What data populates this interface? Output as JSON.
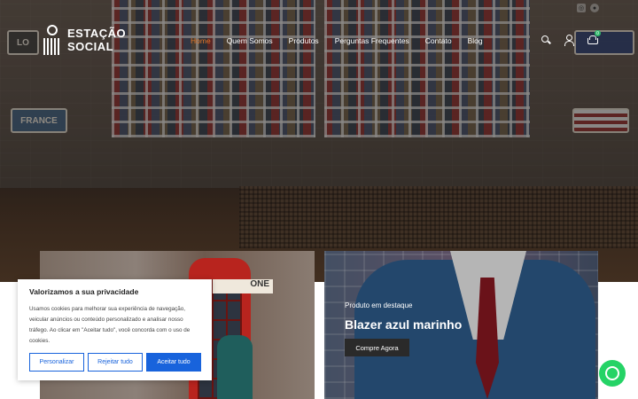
{
  "logo": {
    "line1": "ESTAÇÃO",
    "line2": "SOCIAL"
  },
  "nav": [
    {
      "label": "Home",
      "active": true
    },
    {
      "label": "Quem Somos"
    },
    {
      "label": "Produtos"
    },
    {
      "label": "Perguntas Frequentes"
    },
    {
      "label": "Contato"
    },
    {
      "label": "Blog"
    }
  ],
  "social_icons": [
    "instagram-icon",
    "facebook-icon"
  ],
  "header_icons": [
    "search-icon",
    "user-icon",
    "cart-icon"
  ],
  "cart": {
    "count": "0"
  },
  "hero_signs": {
    "love": "LO",
    "france": "FRANCE"
  },
  "card_left": {
    "sign": "ONE"
  },
  "featured": {
    "label": "Produto em destaque",
    "title": "Blazer azul marinho",
    "button": "Compre Agora"
  },
  "cookie": {
    "title": "Valorizamos a sua privacidade",
    "text": "Usamos cookies para melhorar sua experiência de navegação, veicular anúncios ou conteúdo personalizado e analisar nosso tráfego. Ao clicar em \"Aceitar tudo\", você concorda com o uso de cookies.",
    "customize": "Personalizar",
    "reject": "Rejeitar tudo",
    "accept": "Aceitar tudo"
  },
  "colors": {
    "accent": "#e0752a",
    "cookie_blue": "#1863dc",
    "whatsapp": "#25d366",
    "cart_badge": "#2fb86a"
  }
}
